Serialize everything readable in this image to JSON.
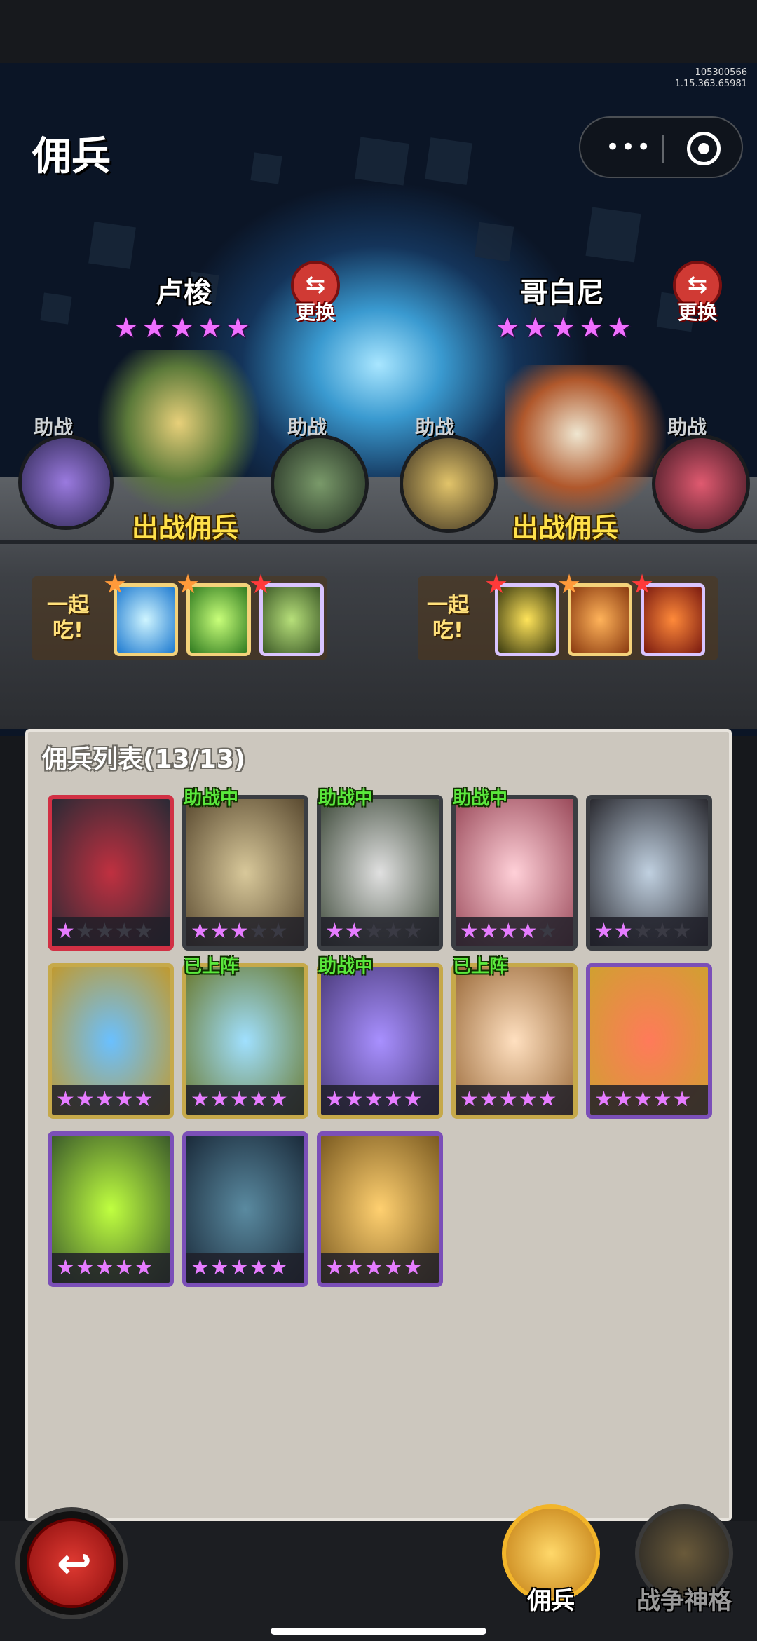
{
  "header": {
    "title": "佣兵",
    "version_line1": "105300566",
    "version_line2": "1.15.363.65981"
  },
  "capsule": {
    "more_icon": "more-dots-icon",
    "close_icon": "target-close-icon"
  },
  "teams": [
    {
      "name": "卢梭",
      "stars": 5,
      "swap_label": "更换",
      "assist_label": "助战",
      "deploy_label": "出战佣兵",
      "eat_label": "一起吃!"
    },
    {
      "name": "哥白尼",
      "stars": 5,
      "swap_label": "更换",
      "assist_label": "助战",
      "deploy_label": "出战佣兵",
      "eat_label": "一起吃!"
    }
  ],
  "list": {
    "title": "佣兵列表(13/13)",
    "cards": [
      {
        "stars": 1,
        "tag": "",
        "frame": "red"
      },
      {
        "stars": 3,
        "tag": "助战中",
        "frame": "gray"
      },
      {
        "stars": 2,
        "tag": "助战中",
        "frame": "gray"
      },
      {
        "stars": 4,
        "tag": "助战中",
        "frame": "gray"
      },
      {
        "stars": 2,
        "tag": "",
        "frame": "gray"
      },
      {
        "stars": 5,
        "tag": "",
        "frame": "gold"
      },
      {
        "stars": 5,
        "tag": "已上阵",
        "frame": "gold"
      },
      {
        "stars": 5,
        "tag": "助战中",
        "frame": "gold"
      },
      {
        "stars": 5,
        "tag": "已上阵",
        "frame": "gold"
      },
      {
        "stars": 5,
        "tag": "",
        "frame": "purple"
      },
      {
        "stars": 5,
        "tag": "",
        "frame": "purple"
      },
      {
        "stars": 5,
        "tag": "",
        "frame": "purple"
      },
      {
        "stars": 5,
        "tag": "",
        "frame": "purple"
      }
    ]
  },
  "bottom": {
    "mercenary_tab": "佣兵",
    "artifact_tab": "战争神格",
    "back_icon": "back-arrow-icon"
  }
}
